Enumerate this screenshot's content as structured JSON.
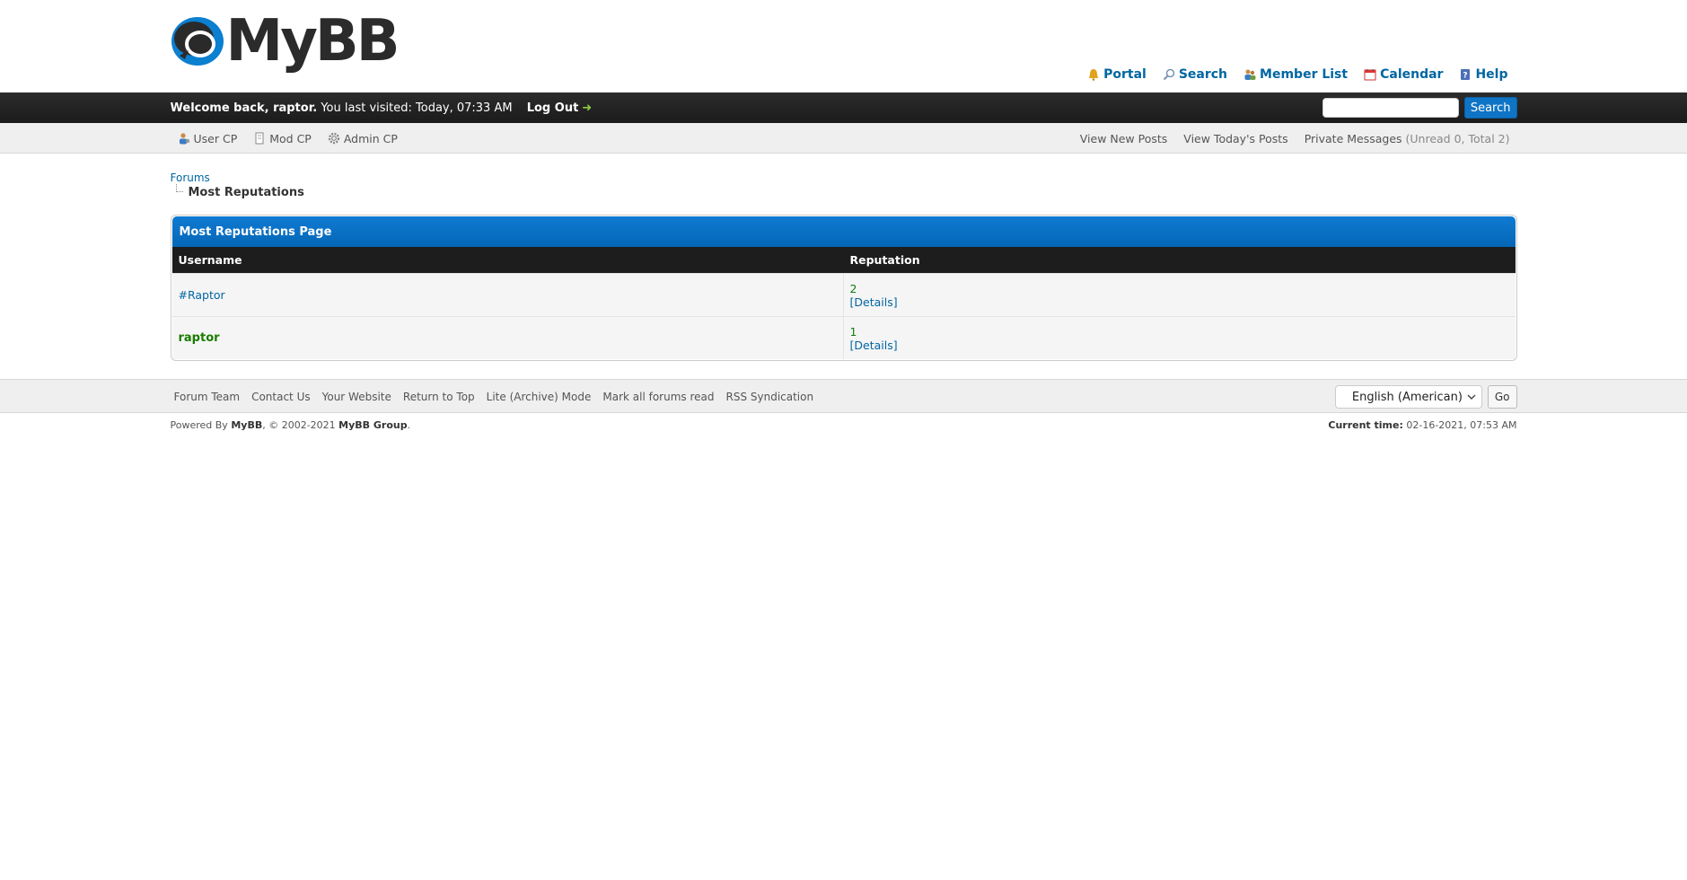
{
  "brand": {
    "logo_text": "MyBB"
  },
  "toplinks": [
    {
      "label": "Portal",
      "icon": "portal-icon"
    },
    {
      "label": "Search",
      "icon": "search-icon"
    },
    {
      "label": "Member List",
      "icon": "member-list-icon"
    },
    {
      "label": "Calendar",
      "icon": "calendar-icon"
    },
    {
      "label": "Help",
      "icon": "help-icon"
    }
  ],
  "welcome": {
    "greeting": "Welcome back, raptor.",
    "last_visit": " You last visited: Today, 07:33 AM",
    "logout_label": "Log Out",
    "logout_arrow": "➜"
  },
  "search": {
    "placeholder": "",
    "button_label": "Search"
  },
  "subnav": {
    "cp_links": [
      "User CP",
      "Mod CP",
      "Admin CP"
    ],
    "new_posts": "View New Posts",
    "todays_posts": "View Today's Posts",
    "pm_label": "Private Messages",
    "pm_count": " (Unread 0, Total 2)"
  },
  "breadcrumb": {
    "root": "Forums",
    "current": "Most Reputations"
  },
  "table": {
    "title": "Most Reputations Page",
    "headers": {
      "username": "Username",
      "reputation": "Reputation"
    },
    "rows": [
      {
        "username": "#Raptor",
        "reputation": "2",
        "details": "[Details]"
      },
      {
        "username": "raptor",
        "reputation": "1",
        "details": "[Details]"
      }
    ]
  },
  "footer": {
    "links": [
      "Forum Team",
      "Contact Us",
      "Your Website",
      "Return to Top",
      "Lite (Archive) Mode",
      "Mark all forums read",
      "RSS Syndication"
    ],
    "language": "English (American)",
    "go_label": "Go",
    "powered_prefix": "Powered By ",
    "powered_name": "MyBB",
    "powered_mid": ", © 2002-2021 ",
    "powered_group": "MyBB Group",
    "powered_suffix": ".",
    "current_time_label": "Current time:",
    "current_time_value": " 02-16-2021, 07:53 AM"
  }
}
